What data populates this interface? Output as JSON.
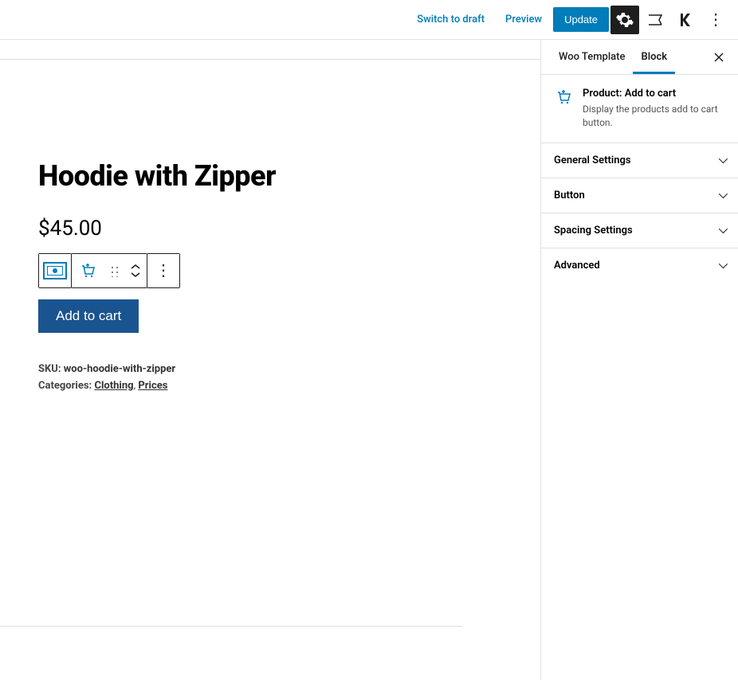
{
  "toolbar": {
    "switch_draft": "Switch to draft",
    "preview": "Preview",
    "update": "Update"
  },
  "product": {
    "title": "Hoodie with Zipper",
    "price": "$45.00",
    "add_to_cart": "Add to cart",
    "sku_label": "SKU: ",
    "sku_value": "woo-hoodie-with-zipper",
    "categories_label": "Categories: ",
    "cat1": "Clothing",
    "cat_sep": ", ",
    "cat2": "Prices"
  },
  "sidebar": {
    "tab1": "Woo Template",
    "tab2": "Block",
    "block_title": "Product: Add to cart",
    "block_desc": "Display the products add to cart button.",
    "panels": {
      "p0": "General Settings",
      "p1": "Button",
      "p2": "Spacing Settings",
      "p3": "Advanced"
    }
  }
}
